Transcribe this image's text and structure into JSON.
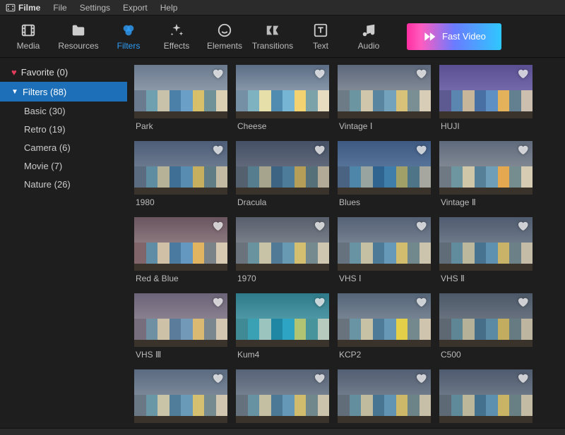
{
  "app": {
    "name": "Filme"
  },
  "menubar": [
    "File",
    "Settings",
    "Export",
    "Help"
  ],
  "toolbar": {
    "items": [
      {
        "id": "media",
        "label": "Media"
      },
      {
        "id": "resources",
        "label": "Resources"
      },
      {
        "id": "filters",
        "label": "Filters",
        "active": true
      },
      {
        "id": "effects",
        "label": "Effects"
      },
      {
        "id": "elements",
        "label": "Elements"
      },
      {
        "id": "transitions",
        "label": "Transitions"
      },
      {
        "id": "text",
        "label": "Text"
      },
      {
        "id": "audio",
        "label": "Audio"
      }
    ],
    "fast_video": "Fast Video"
  },
  "sidebar": {
    "favorite": {
      "label": "Favorite",
      "count": 0
    },
    "filters": {
      "label": "Filters",
      "count": 88
    },
    "categories": [
      {
        "label": "Basic",
        "count": 30
      },
      {
        "label": "Retro",
        "count": 19
      },
      {
        "label": "Camera",
        "count": 6
      },
      {
        "label": "Movie",
        "count": 7
      },
      {
        "label": "Nature",
        "count": 26
      }
    ]
  },
  "filters": [
    {
      "label": "Park",
      "sky": "linear-gradient(#6b7a8f,#aeb9c2)",
      "h": [
        "#6a7b8f",
        "#6fa0b0",
        "#c8c2aa",
        "#4b80a8",
        "#6aa0c7",
        "#d8c06a",
        "#6f9298",
        "#dcd0b4"
      ]
    },
    {
      "label": "Cheese",
      "sky": "linear-gradient(#5c6e86,#b6c2cd)",
      "h": [
        "#7590a5",
        "#7fb2c0",
        "#e6dfaa",
        "#4f8cb0",
        "#77b5d4",
        "#f2d271",
        "#7aa2a8",
        "#e7dcc0"
      ]
    },
    {
      "label": "Vintage Ⅰ",
      "sky": "linear-gradient(#5c687c,#a8adb0)",
      "h": [
        "#6d7b87",
        "#6b95a0",
        "#cfc6ab",
        "#5985a0",
        "#72a2bc",
        "#d8c27a",
        "#7a8f93",
        "#d8ceb7"
      ]
    },
    {
      "label": "HUJI",
      "sky": "linear-gradient(#5a4f92,#8f86c4)",
      "h": [
        "#5c5a90",
        "#5a86b0",
        "#c7b69a",
        "#4970a5",
        "#5f90c4",
        "#e3b25a",
        "#638090",
        "#cdbfb0"
      ]
    },
    {
      "label": "1980",
      "sky": "linear-gradient(#4d5d78,#8b97a5)",
      "h": [
        "#5c6c80",
        "#5e8ca0",
        "#b6b298",
        "#3f6f95",
        "#588cb0",
        "#c6b060",
        "#607c84",
        "#c3baa4"
      ]
    },
    {
      "label": "Dracula",
      "sky": "linear-gradient(#455066,#7d8591)",
      "h": [
        "#55606f",
        "#567d8d",
        "#a7a48e",
        "#3d6482",
        "#4d7b9a",
        "#b49e58",
        "#56707a",
        "#b2aa96"
      ]
    },
    {
      "label": "Blues",
      "sky": "linear-gradient(#3e5a82,#6f8db0)",
      "h": [
        "#4a6382",
        "#4d86a8",
        "#97a4a0",
        "#2f6390",
        "#3f7daa",
        "#a0a068",
        "#4e7488",
        "#a6a8a0"
      ]
    },
    {
      "label": "Vintage Ⅱ",
      "sky": "linear-gradient(#5f6a7c,#a2a7ab)",
      "h": [
        "#6e7983",
        "#6d96a0",
        "#d0c7a8",
        "#567f98",
        "#6f9fb8",
        "#e4a850",
        "#768d90",
        "#d6ccb4"
      ]
    },
    {
      "label": "Red & Blue",
      "sky": "linear-gradient(#6a5560,#b0a0a0)",
      "h": [
        "#80666a",
        "#5f8da5",
        "#d0c0a6",
        "#4a7aa0",
        "#6498c0",
        "#e0b460",
        "#7a8488",
        "#d8c9b2"
      ]
    },
    {
      "label": "1970",
      "sky": "linear-gradient(#585f6c,#9ba1a7)",
      "h": [
        "#6a727c",
        "#6a93a0",
        "#c8c2a6",
        "#507a95",
        "#689ab4",
        "#d4be70",
        "#748a8e",
        "#d0c7b0"
      ]
    },
    {
      "label": "VHS Ⅰ",
      "sky": "linear-gradient(#556276,#96a0ab)",
      "h": [
        "#67727f",
        "#6793a3",
        "#c5c0a4",
        "#4d7a97",
        "#6599b7",
        "#d2bc6e",
        "#71888d",
        "#cdc4ae"
      ]
    },
    {
      "label": "VHS Ⅱ",
      "sky": "linear-gradient(#4f5b6f,#8e98a3)",
      "h": [
        "#616c79",
        "#608c9d",
        "#bcb89e",
        "#477391",
        "#5e91b0",
        "#c9b368",
        "#6b8187",
        "#c5bca7"
      ]
    },
    {
      "label": "VHS Ⅲ",
      "sky": "linear-gradient(#6c6478,#a89fa8)",
      "h": [
        "#766e7c",
        "#6f90a2",
        "#cdc1a8",
        "#5b7c9a",
        "#7299b8",
        "#dab972",
        "#7b878e",
        "#d3c7b2"
      ]
    },
    {
      "label": "Kum4",
      "sky": "linear-gradient(#2f7a8a,#6fb8c4)",
      "h": [
        "#3f8a94",
        "#3aa0b4",
        "#9cc4be",
        "#1f86a4",
        "#2ea4c4",
        "#b0c474",
        "#48949c",
        "#b6cabe"
      ]
    },
    {
      "label": "KCP2",
      "sky": "linear-gradient(#556578,#9aa4ae)",
      "h": [
        "#68737e",
        "#6894a3",
        "#c7c1a5",
        "#4e7b97",
        "#6799b6",
        "#e4d048",
        "#73898e",
        "#cfc5af"
      ]
    },
    {
      "label": "C500",
      "sky": "linear-gradient(#4c5868,#878f98)",
      "h": [
        "#5e6872",
        "#5e8694",
        "#b5b198",
        "#466e88",
        "#5a8aa4",
        "#c2ac60",
        "#667c82",
        "#beb5a0"
      ]
    },
    {
      "label": "",
      "sky": "linear-gradient(#5a6a80,#9ca8b2)",
      "h": [
        "#6a7885",
        "#6a97a6",
        "#c9c3a7",
        "#507d99",
        "#699bb9",
        "#d5bf70",
        "#758b90",
        "#d1c7b1"
      ]
    },
    {
      "label": "",
      "sky": "linear-gradient(#566276,#949ea9)",
      "h": [
        "#66717e",
        "#6692a2",
        "#c4bfa3",
        "#4c7996",
        "#6498b6",
        "#d1bb6d",
        "#70878c",
        "#ccc3ad"
      ]
    },
    {
      "label": "",
      "sky": "linear-gradient(#525e72,#9099a4)",
      "h": [
        "#626d7a",
        "#628e9e",
        "#c0bb9f",
        "#487592",
        "#6094b2",
        "#cdb769",
        "#6c8388",
        "#c8bfa9"
      ]
    },
    {
      "label": "",
      "sky": "linear-gradient(#4e5a6e,#8c95a0)",
      "h": [
        "#5e6976",
        "#5e8a9a",
        "#bcb79b",
        "#44718e",
        "#5c90ae",
        "#c9b365",
        "#688084",
        "#c4bba5"
      ]
    }
  ]
}
